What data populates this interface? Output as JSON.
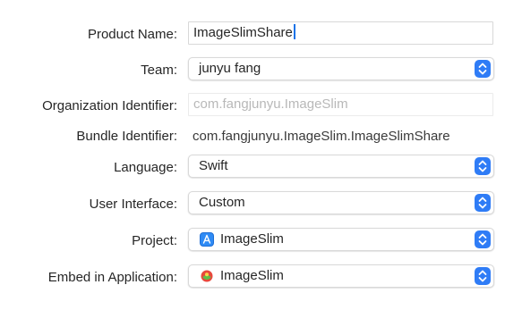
{
  "form": {
    "product_name": {
      "label": "Product Name:",
      "value": "ImageSlimShare"
    },
    "team": {
      "label": "Team:",
      "value": "junyu fang"
    },
    "organization_identifier": {
      "label": "Organization Identifier:",
      "placeholder": "com.fangjunyu.ImageSlim"
    },
    "bundle_identifier": {
      "label": "Bundle Identifier:",
      "value": "com.fangjunyu.ImageSlim.ImageSlimShare"
    },
    "language": {
      "label": "Language:",
      "value": "Swift"
    },
    "user_interface": {
      "label": "User Interface:",
      "value": "Custom"
    },
    "project": {
      "label": "Project:",
      "value": "ImageSlim",
      "icon": "xcode-project-icon"
    },
    "embed_in_application": {
      "label": "Embed in Application:",
      "value": "ImageSlim",
      "icon": "app-target-icon"
    }
  },
  "colors": {
    "accent": "#2f7cf6",
    "caret": "#1a73e8",
    "placeholder_text": "#b8b8b8"
  }
}
